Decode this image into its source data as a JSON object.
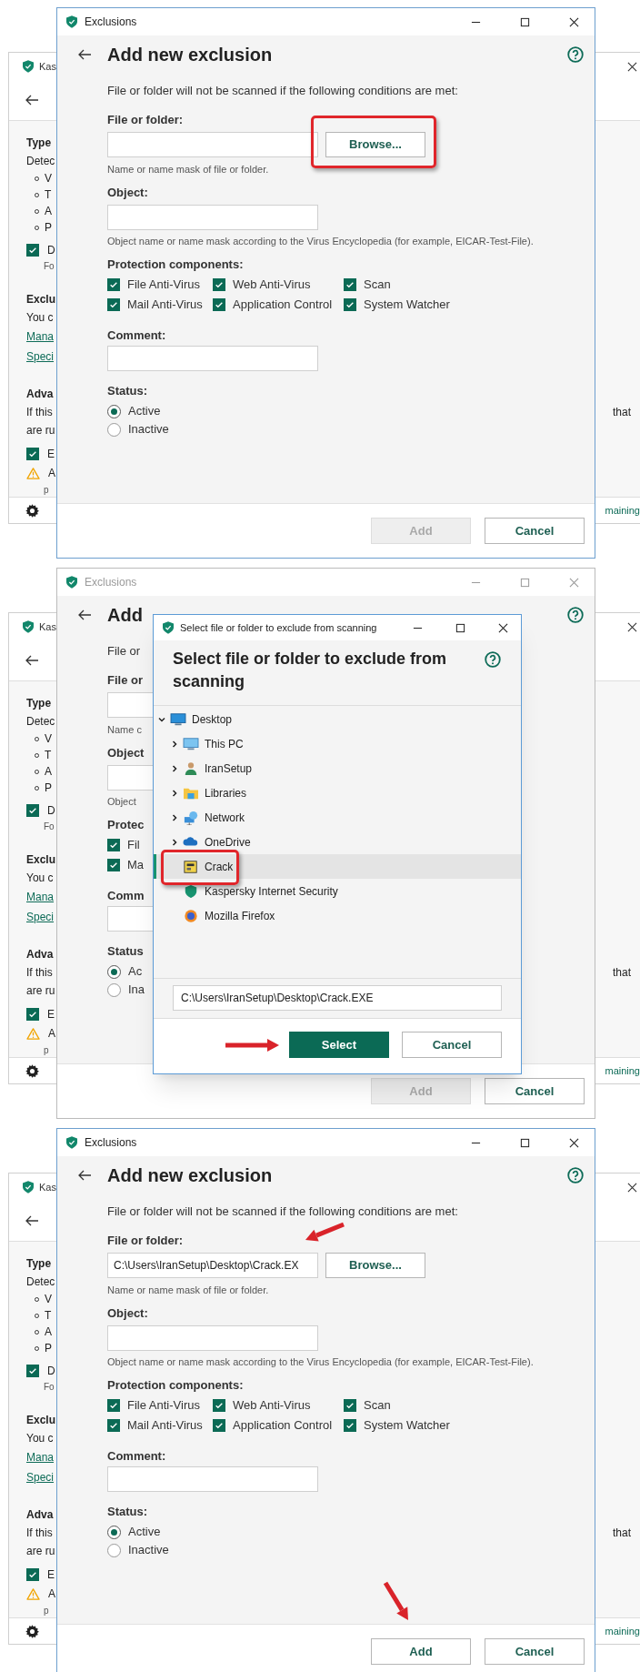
{
  "steps": [
    {
      "background_window": {
        "title": "Kas",
        "lines": [
          {
            "kind": "heading",
            "text": "Type"
          },
          {
            "kind": "text",
            "text": "Detec"
          },
          {
            "kind": "bullet",
            "text": "V"
          },
          {
            "kind": "bullet",
            "text": "T"
          },
          {
            "kind": "bullet",
            "text": "A"
          },
          {
            "kind": "bullet",
            "text": "P"
          },
          {
            "kind": "checkbox",
            "text": "D",
            "checked": true
          },
          {
            "kind": "note",
            "text": "Fo"
          },
          {
            "kind": "heading",
            "text": "Exclu"
          },
          {
            "kind": "text",
            "text": "You c"
          },
          {
            "kind": "link",
            "text": "Mana"
          },
          {
            "kind": "link",
            "text": "Speci"
          },
          {
            "kind": "heading",
            "text": "Adva"
          },
          {
            "kind": "text",
            "text": "If this",
            "right_text": "that"
          },
          {
            "kind": "text",
            "text": "are ru"
          },
          {
            "kind": "checkbox",
            "text": "E",
            "checked": true
          },
          {
            "kind": "warning",
            "text": "A"
          },
          {
            "kind": "note",
            "text": "p"
          }
        ],
        "footer_text": "maining"
      },
      "exclusions_dialog": {
        "title": "Exclusions",
        "active": true,
        "heading": "Add new exclusion",
        "description": "File or folder will not be scanned if the following conditions are met:",
        "file_field": {
          "label": "File or folder:",
          "hint": "Name or name mask of file or folder.",
          "button": "Browse..."
        },
        "object_field": {
          "label": "Object:",
          "hint": "Object name or name mask according to the Virus Encyclopedia (for example, EICAR-Test-File)."
        },
        "components": {
          "label": "Protection components:",
          "rows": [
            [
              {
                "label": "File Anti-Virus",
                "checked": true
              },
              {
                "label": "Web Anti-Virus",
                "checked": true
              },
              {
                "label": "Scan",
                "checked": true
              }
            ],
            [
              {
                "label": "Mail Anti-Virus",
                "checked": true
              },
              {
                "label": "Application Control",
                "checked": true
              },
              {
                "label": "System Watcher",
                "checked": true
              }
            ]
          ]
        },
        "comment": {
          "label": "Comment:"
        },
        "status": {
          "label": "Status:",
          "options": [
            {
              "label": "Active",
              "selected": true
            },
            {
              "label": "Inactive",
              "selected": false
            }
          ]
        },
        "buttons": [
          {
            "label": "Add",
            "disabled": true
          },
          {
            "label": "Cancel",
            "disabled": false
          }
        ]
      },
      "annotations": [
        {
          "kind": "highlight"
        }
      ]
    },
    {
      "background_window": {
        "title": "Kas",
        "lines": [
          {
            "kind": "heading",
            "text": "Type"
          },
          {
            "kind": "text",
            "text": "Detec"
          },
          {
            "kind": "bullet",
            "text": "V"
          },
          {
            "kind": "bullet",
            "text": "T"
          },
          {
            "kind": "bullet",
            "text": "A"
          },
          {
            "kind": "bullet",
            "text": "P"
          },
          {
            "kind": "checkbox",
            "text": "D",
            "checked": true
          },
          {
            "kind": "note",
            "text": "Fo"
          },
          {
            "kind": "heading",
            "text": "Exclu"
          },
          {
            "kind": "text",
            "text": "You c"
          },
          {
            "kind": "link",
            "text": "Mana"
          },
          {
            "kind": "link",
            "text": "Speci"
          },
          {
            "kind": "heading",
            "text": "Adva"
          },
          {
            "kind": "text",
            "text": "If this",
            "right_text": "that"
          },
          {
            "kind": "text",
            "text": "are ru"
          },
          {
            "kind": "checkbox",
            "text": "E",
            "checked": true
          },
          {
            "kind": "warning",
            "text": "A"
          },
          {
            "kind": "note",
            "text": "p"
          }
        ],
        "footer_text": "maining"
      },
      "exclusions_dialog": {
        "title": "Exclusions",
        "active": false,
        "heading": "Add",
        "description": "File or",
        "file_field": {
          "label": "File or",
          "hint": "Name c"
        },
        "object_field": {
          "label": "Object",
          "hint": "Object"
        },
        "components": {
          "label": "Protec",
          "rows": [
            [
              {
                "label": "Fil",
                "checked": true
              }
            ],
            [
              {
                "label": "Ma",
                "checked": true
              }
            ]
          ]
        },
        "comment": {
          "label": "Comm"
        },
        "status": {
          "label": "Status",
          "options": [
            {
              "label": "Ac",
              "selected": true
            },
            {
              "label": "Ina",
              "selected": false
            }
          ]
        },
        "buttons": [
          {
            "label": "Add",
            "disabled": true
          },
          {
            "label": "Cancel",
            "disabled": false
          }
        ]
      },
      "select_dialog": {
        "title": "Select file or folder to exclude from scanning",
        "heading": "Select file or folder to exclude from scanning",
        "tree": [
          {
            "label": "Desktop",
            "kind": "folder",
            "expanded": true,
            "selected": false,
            "children": [
              {
                "label": "This PC",
                "kind": "folder",
                "expanded": false,
                "selected": false
              },
              {
                "label": "IranSetup",
                "kind": "folder",
                "expanded": false,
                "selected": false
              },
              {
                "label": "Libraries",
                "kind": "folder",
                "expanded": false,
                "selected": false
              },
              {
                "label": "Network",
                "kind": "folder",
                "expanded": false,
                "selected": false
              },
              {
                "label": "OneDrive",
                "kind": "folder",
                "expanded": false,
                "selected": false
              },
              {
                "label": "Crack",
                "kind": "file",
                "selected": true
              },
              {
                "label": "Kaspersky Internet Security",
                "kind": "file",
                "selected": false
              },
              {
                "label": "Mozilla Firefox",
                "kind": "file",
                "selected": false
              }
            ]
          }
        ],
        "path": "C:\\Users\\IranSetup\\Desktop\\Crack.EXE",
        "buttons": [
          {
            "label": "Select",
            "kind": "primary"
          },
          {
            "label": "Cancel",
            "kind": "secondary"
          }
        ]
      },
      "annotations": [
        {
          "kind": "highlight"
        },
        {
          "kind": "arrow"
        }
      ]
    },
    {
      "background_window": {
        "title": "Kas",
        "lines": [
          {
            "kind": "heading",
            "text": "Type"
          },
          {
            "kind": "text",
            "text": "Detec"
          },
          {
            "kind": "bullet",
            "text": "V"
          },
          {
            "kind": "bullet",
            "text": "T"
          },
          {
            "kind": "bullet",
            "text": "A"
          },
          {
            "kind": "bullet",
            "text": "P"
          },
          {
            "kind": "checkbox",
            "text": "D",
            "checked": true
          },
          {
            "kind": "note",
            "text": "Fo"
          },
          {
            "kind": "heading",
            "text": "Exclu"
          },
          {
            "kind": "text",
            "text": "You c"
          },
          {
            "kind": "link",
            "text": "Mana"
          },
          {
            "kind": "link",
            "text": "Speci"
          },
          {
            "kind": "heading",
            "text": "Adva"
          },
          {
            "kind": "text",
            "text": "If this",
            "right_text": "that"
          },
          {
            "kind": "text",
            "text": "are ru"
          },
          {
            "kind": "checkbox",
            "text": "E",
            "checked": true
          },
          {
            "kind": "warning",
            "text": "A"
          },
          {
            "kind": "note",
            "text": "p"
          }
        ],
        "footer_text": "maining"
      },
      "exclusions_dialog": {
        "title": "Exclusions",
        "active": true,
        "heading": "Add new exclusion",
        "description": "File or folder will not be scanned if the following conditions are met:",
        "file_field": {
          "label": "File or folder:",
          "value": "C:\\Users\\IranSetup\\Desktop\\Crack.EX",
          "hint": "Name or name mask of file or folder.",
          "button": "Browse..."
        },
        "object_field": {
          "label": "Object:",
          "hint": "Object name or name mask according to the Virus Encyclopedia (for example, EICAR-Test-File)."
        },
        "components": {
          "label": "Protection components:",
          "rows": [
            [
              {
                "label": "File Anti-Virus",
                "checked": true
              },
              {
                "label": "Web Anti-Virus",
                "checked": true
              },
              {
                "label": "Scan",
                "checked": true
              }
            ],
            [
              {
                "label": "Mail Anti-Virus",
                "checked": true
              },
              {
                "label": "Application Control",
                "checked": true
              },
              {
                "label": "System Watcher",
                "checked": true
              }
            ]
          ]
        },
        "comment": {
          "label": "Comment:"
        },
        "status": {
          "label": "Status:",
          "options": [
            {
              "label": "Active",
              "selected": true
            },
            {
              "label": "Inactive",
              "selected": false
            }
          ]
        },
        "buttons": [
          {
            "label": "Add",
            "disabled": false
          },
          {
            "label": "Cancel",
            "disabled": false
          }
        ]
      },
      "annotations": [
        {
          "kind": "arrow"
        },
        {
          "kind": "arrow"
        }
      ]
    }
  ]
}
